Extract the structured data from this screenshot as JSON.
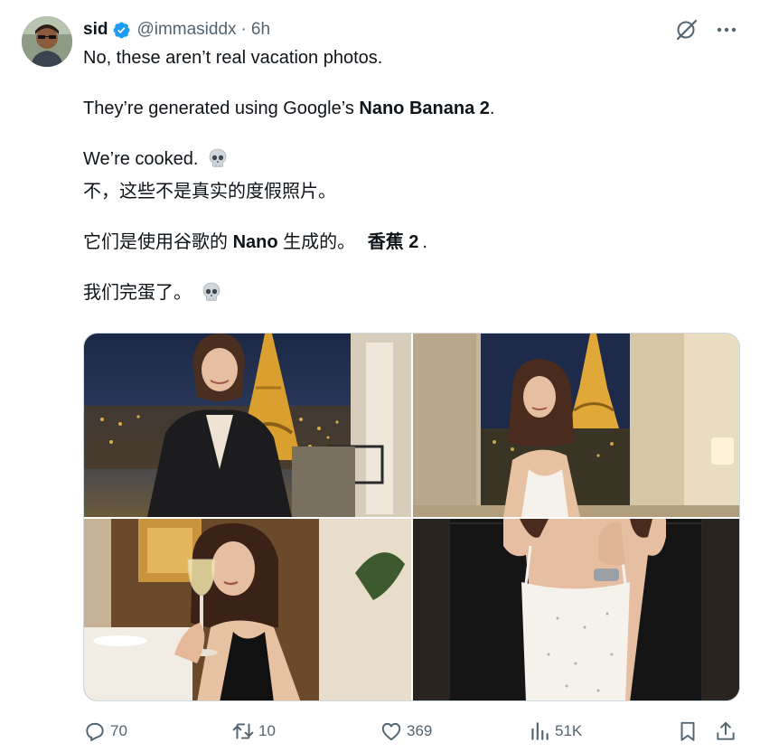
{
  "author": {
    "name": "sid",
    "handle": "@immasiddx",
    "separator": "·",
    "time": "6h",
    "verified": true
  },
  "icons": {
    "avatar": "user-avatar",
    "verified": "verified-badge-icon",
    "grok": "grok-icon",
    "more": "more-icon",
    "reply": "reply-icon",
    "repost": "repost-icon",
    "like": "like-icon",
    "views": "views-icon",
    "bookmark": "bookmark-icon",
    "share": "share-icon",
    "skull": "skull-emoji"
  },
  "text": {
    "line1": "No, these aren’t real vacation photos.",
    "line2_pre": "They’re generated using Google’s ",
    "line2_bold": "Nano Banana 2",
    "line2_post": ".",
    "line3": "We’re cooked.",
    "zh_line1": "不，这些不是真实的度假照片。",
    "zh_line2_pre": "它们是使用谷歌的 ",
    "zh_line2_bold": "Nano",
    "zh_line2_mid": " 生成的。 ",
    "zh_line2_bold2": "香蕉 2",
    "zh_line2_post": ".",
    "zh_line3": "我们完蛋了。"
  },
  "stats": {
    "replies": "70",
    "reposts": "10",
    "likes": "369",
    "views": "51K"
  },
  "colors": {
    "text": "#0f1419",
    "secondary": "#536471",
    "verified": "#1d9bf0",
    "border": "#cfd9de"
  }
}
